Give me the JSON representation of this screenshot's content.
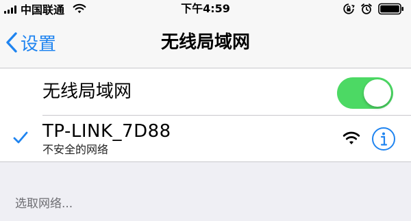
{
  "status_bar": {
    "carrier": "中国联通",
    "time": "下午4:59",
    "icons": [
      "signal-icon",
      "wifi-icon",
      "orientation-lock-icon",
      "alarm-icon",
      "battery-icon"
    ]
  },
  "nav": {
    "back_label": "设置",
    "title": "无线局域网",
    "accent_color": "#1f84f0"
  },
  "wifi_toggle": {
    "label": "无线局域网",
    "on": true,
    "color": "#4cd964"
  },
  "current_network": {
    "name": "TP-LINK_7D88",
    "security": "不安全的网络",
    "connected": true
  },
  "choose_network": {
    "header": "选取网络..."
  }
}
